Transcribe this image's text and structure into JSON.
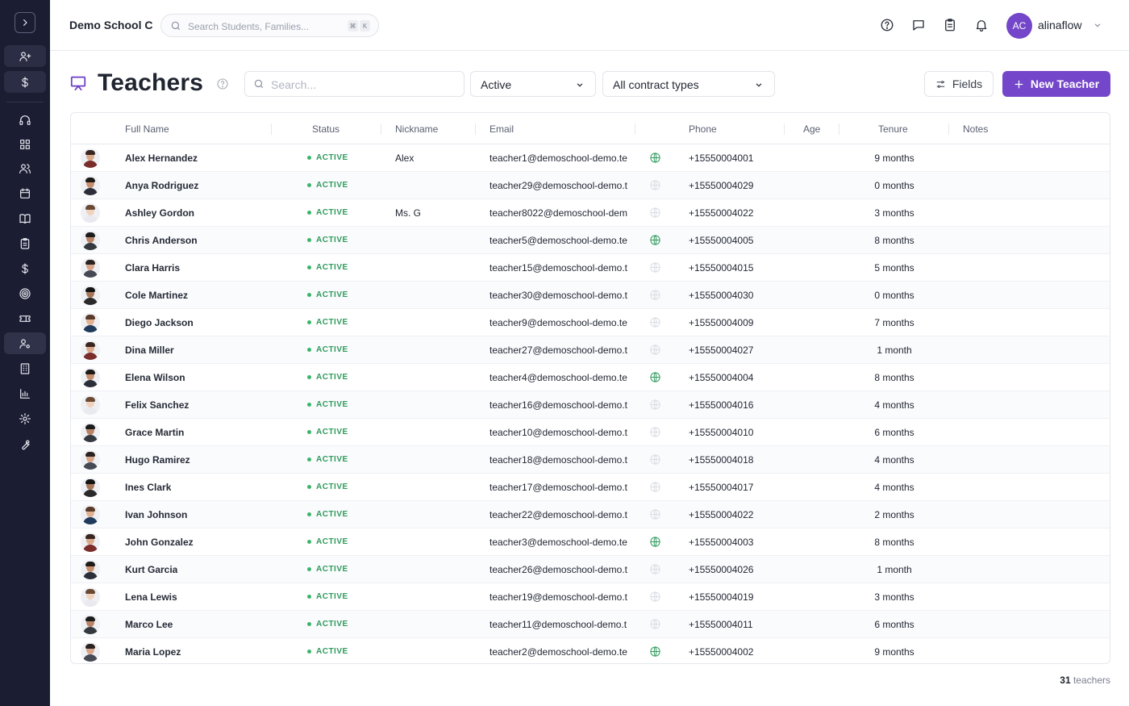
{
  "sidebar": {
    "toggle_icon": "chevron-right-icon",
    "items": [
      {
        "name": "add-user",
        "icon": "user-plus-icon"
      },
      {
        "name": "billing",
        "icon": "dollar-icon"
      },
      {
        "name": "support",
        "icon": "headset-icon"
      },
      {
        "name": "dashboard",
        "icon": "grid-icon"
      },
      {
        "name": "people",
        "icon": "users-icon"
      },
      {
        "name": "calendar",
        "icon": "calendar-icon"
      },
      {
        "name": "courses",
        "icon": "book-icon"
      },
      {
        "name": "tasks",
        "icon": "clipboard-icon"
      },
      {
        "name": "payments",
        "icon": "dollar-icon"
      },
      {
        "name": "goals",
        "icon": "target-icon"
      },
      {
        "name": "tickets",
        "icon": "ticket-icon"
      },
      {
        "name": "teachers",
        "icon": "user-cog-icon",
        "active": true
      },
      {
        "name": "buildings",
        "icon": "building-icon"
      },
      {
        "name": "reports",
        "icon": "bar-chart-icon"
      },
      {
        "name": "settings",
        "icon": "gear-icon"
      },
      {
        "name": "tools",
        "icon": "wrench-icon"
      }
    ]
  },
  "topbar": {
    "school_name": "Demo School C",
    "search_placeholder": "Search Students, Families...",
    "shortcut_keys": [
      "⌘",
      "K"
    ],
    "user_initials": "AC",
    "username": "alinaflow"
  },
  "header": {
    "title": "Teachers",
    "search_placeholder": "Search...",
    "status_filter": "Active",
    "contract_filter": "All contract types",
    "fields_label": "Fields",
    "new_label": "New Teacher"
  },
  "table": {
    "columns": [
      "Full Name",
      "Status",
      "Nickname",
      "Email",
      "Phone",
      "Age",
      "Tenure",
      "Notes"
    ],
    "rows": [
      {
        "name": "Alex Hernandez",
        "status": "ACTIVE",
        "nickname": "Alex",
        "email": "teacher1@demoschool-demo.te",
        "web": true,
        "phone": "+15550004001",
        "tenure": "9 months"
      },
      {
        "name": "Anya Rodriguez",
        "status": "ACTIVE",
        "nickname": "",
        "email": "teacher29@demoschool-demo.t",
        "web": false,
        "phone": "+15550004029",
        "tenure": "0 months"
      },
      {
        "name": "Ashley Gordon",
        "status": "ACTIVE",
        "nickname": "Ms. G",
        "email": "teacher8022@demoschool-dem",
        "web": false,
        "phone": "+15550004022",
        "tenure": "3 months"
      },
      {
        "name": "Chris Anderson",
        "status": "ACTIVE",
        "nickname": "",
        "email": "teacher5@demoschool-demo.te",
        "web": true,
        "phone": "+15550004005",
        "tenure": "8 months"
      },
      {
        "name": "Clara Harris",
        "status": "ACTIVE",
        "nickname": "",
        "email": "teacher15@demoschool-demo.t",
        "web": false,
        "phone": "+15550004015",
        "tenure": "5 months"
      },
      {
        "name": "Cole Martinez",
        "status": "ACTIVE",
        "nickname": "",
        "email": "teacher30@demoschool-demo.t",
        "web": false,
        "phone": "+15550004030",
        "tenure": "0 months"
      },
      {
        "name": "Diego Jackson",
        "status": "ACTIVE",
        "nickname": "",
        "email": "teacher9@demoschool-demo.te",
        "web": false,
        "phone": "+15550004009",
        "tenure": "7 months"
      },
      {
        "name": "Dina Miller",
        "status": "ACTIVE",
        "nickname": "",
        "email": "teacher27@demoschool-demo.t",
        "web": false,
        "phone": "+15550004027",
        "tenure": "1 month"
      },
      {
        "name": "Elena Wilson",
        "status": "ACTIVE",
        "nickname": "",
        "email": "teacher4@demoschool-demo.te",
        "web": true,
        "phone": "+15550004004",
        "tenure": "8 months"
      },
      {
        "name": "Felix Sanchez",
        "status": "ACTIVE",
        "nickname": "",
        "email": "teacher16@demoschool-demo.t",
        "web": false,
        "phone": "+15550004016",
        "tenure": "4 months"
      },
      {
        "name": "Grace Martin",
        "status": "ACTIVE",
        "nickname": "",
        "email": "teacher10@demoschool-demo.t",
        "web": false,
        "phone": "+15550004010",
        "tenure": "6 months"
      },
      {
        "name": "Hugo Ramirez",
        "status": "ACTIVE",
        "nickname": "",
        "email": "teacher18@demoschool-demo.t",
        "web": false,
        "phone": "+15550004018",
        "tenure": "4 months"
      },
      {
        "name": "Ines Clark",
        "status": "ACTIVE",
        "nickname": "",
        "email": "teacher17@demoschool-demo.t",
        "web": false,
        "phone": "+15550004017",
        "tenure": "4 months"
      },
      {
        "name": "Ivan Johnson",
        "status": "ACTIVE",
        "nickname": "",
        "email": "teacher22@demoschool-demo.t",
        "web": false,
        "phone": "+15550004022",
        "tenure": "2 months"
      },
      {
        "name": "John Gonzalez",
        "status": "ACTIVE",
        "nickname": "",
        "email": "teacher3@demoschool-demo.te",
        "web": true,
        "phone": "+15550004003",
        "tenure": "8 months"
      },
      {
        "name": "Kurt Garcia",
        "status": "ACTIVE",
        "nickname": "",
        "email": "teacher26@demoschool-demo.t",
        "web": false,
        "phone": "+15550004026",
        "tenure": "1 month"
      },
      {
        "name": "Lena Lewis",
        "status": "ACTIVE",
        "nickname": "",
        "email": "teacher19@demoschool-demo.t",
        "web": false,
        "phone": "+15550004019",
        "tenure": "3 months"
      },
      {
        "name": "Marco Lee",
        "status": "ACTIVE",
        "nickname": "",
        "email": "teacher11@demoschool-demo.t",
        "web": false,
        "phone": "+15550004011",
        "tenure": "6 months"
      },
      {
        "name": "Maria Lopez",
        "status": "ACTIVE",
        "nickname": "",
        "email": "teacher2@demoschool-demo.te",
        "web": true,
        "phone": "+15550004002",
        "tenure": "9 months"
      }
    ]
  },
  "footer": {
    "count": "31",
    "count_label": "teachers"
  },
  "colors": {
    "accent": "#7446c9",
    "sidebar": "#1b1d33",
    "status_active": "#2f9a5c"
  }
}
